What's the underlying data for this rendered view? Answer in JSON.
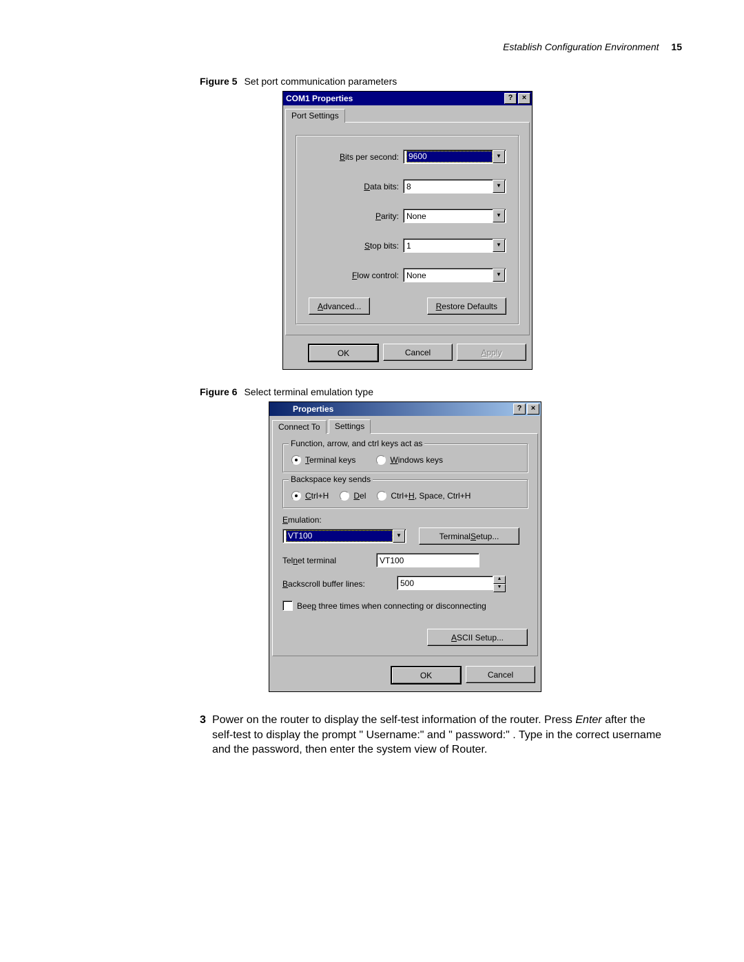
{
  "header": {
    "section": "Establish Configuration Environment",
    "page": "15"
  },
  "fig5": {
    "label": "Figure 5",
    "caption": "Set port communication parameters"
  },
  "fig6": {
    "label": "Figure 6",
    "caption": "Select terminal emulation type"
  },
  "dlg1": {
    "title": "COM1 Properties",
    "tab": "Port Settings",
    "fields": {
      "bps_label": "Bits per second:",
      "bps": "9600",
      "databits_label": "Data bits:",
      "databits": "8",
      "parity_label": "Parity:",
      "parity": "None",
      "stopbits_label": "Stop bits:",
      "stopbits": "1",
      "flow_label": "Flow control:",
      "flow": "None"
    },
    "buttons": {
      "advanced": "Advanced...",
      "restore": "Restore Defaults",
      "ok": "OK",
      "cancel": "Cancel",
      "apply": "Apply"
    }
  },
  "dlg2": {
    "title": "Properties",
    "tabs": {
      "connect": "Connect To",
      "settings": "Settings"
    },
    "group_keys": {
      "label": "Function, arrow, and ctrl keys act as",
      "opt_terminal": "Terminal keys",
      "opt_windows": "Windows keys"
    },
    "group_bksp": {
      "label": "Backspace key sends",
      "opt_ctrlh": "Ctrl+H",
      "opt_del": "Del",
      "opt_chsc": "Ctrl+H, Space, Ctrl+H"
    },
    "emulation_label": "Emulation:",
    "emulation": "VT100",
    "terminal_setup": "Terminal Setup...",
    "telnet_label": "Telnet terminal",
    "telnet": "VT100",
    "backscroll_label": "Backscroll buffer lines:",
    "backscroll": "500",
    "beep": "Beep three times when connecting or disconnecting",
    "ascii_setup": "ASCII Setup...",
    "ok": "OK",
    "cancel": "Cancel"
  },
  "step": {
    "num": "3",
    "text_a": "Power on the router to display the self-test information of the router. Press ",
    "enter": "Enter",
    "text_b": " after the self-test to display the prompt \" Username:\" and \" password:\" . Type in the correct username and the password, then enter the system view of Router."
  }
}
